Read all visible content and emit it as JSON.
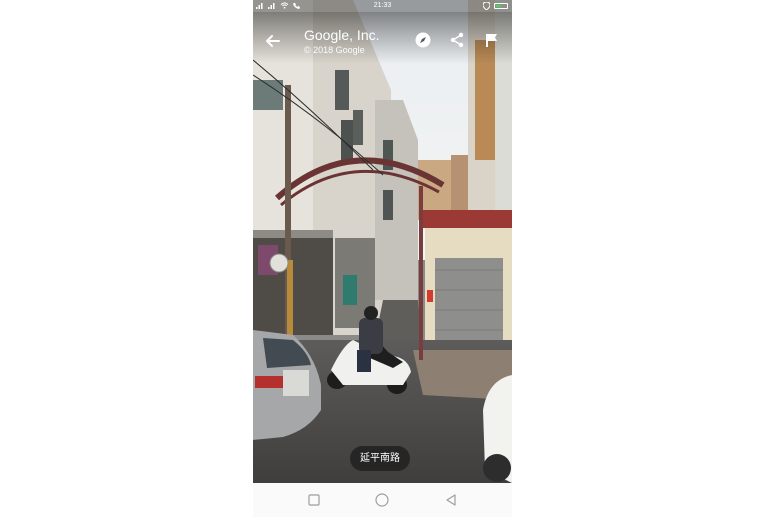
{
  "status_bar": {
    "time": "21:33"
  },
  "header": {
    "title": "Google, Inc.",
    "subtitle": "© 2018 Google",
    "back_icon": "arrow-back-icon",
    "compass_icon": "compass-icon",
    "share_icon": "share-icon",
    "report_icon": "flag-icon"
  },
  "street_label": "延平南路",
  "nav_bar": {
    "recent_icon": "square-icon",
    "home_icon": "circle-icon",
    "back_icon": "triangle-back-icon"
  },
  "colors": {
    "overlay": "#000000",
    "chip": "#212121",
    "arch": "#7a3b3b",
    "battery": "#3ddc57"
  }
}
